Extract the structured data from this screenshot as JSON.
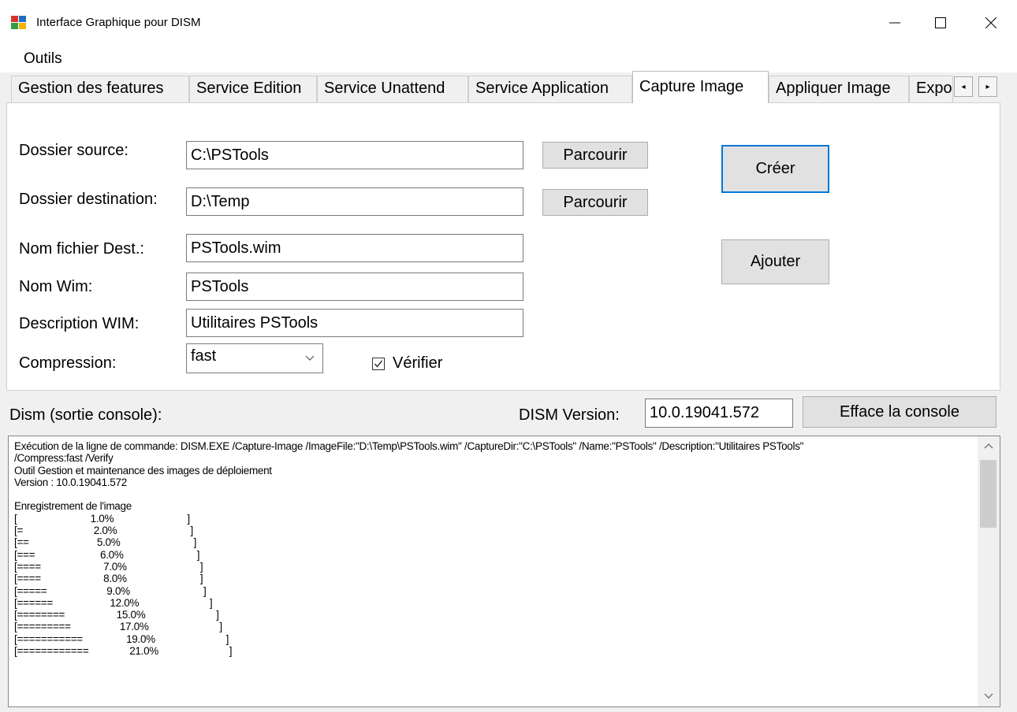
{
  "window": {
    "title": "Interface Graphique pour DISM",
    "minimize_glyph": "—",
    "maximize_glyph": "☐",
    "close_glyph": "✕"
  },
  "menu": {
    "outils": "Outils"
  },
  "tabs": [
    {
      "label": "Gestion des features"
    },
    {
      "label": "Service Edition"
    },
    {
      "label": "Service Unattend"
    },
    {
      "label": "Service Application"
    },
    {
      "label": "Capture Image",
      "active": true
    },
    {
      "label": "Appliquer Image"
    },
    {
      "label": "Exportation"
    }
  ],
  "tab_scroll": {
    "left": "◂",
    "right": "▸"
  },
  "capture": {
    "source_label": "Dossier source:",
    "source_value": "C:\\PSTools",
    "dest_label": "Dossier destination:",
    "dest_value": "D:\\Temp",
    "browse_label": "Parcourir",
    "filename_label": "Nom fichier Dest.:",
    "filename_value": "PSTools.wim",
    "wimname_label": "Nom Wim:",
    "wimname_value": "PSTools",
    "desc_label": "Description WIM:",
    "desc_value": "Utilitaires PSTools",
    "compression_label": "Compression:",
    "compression_value": "fast",
    "verify_label": "Vérifier",
    "verify_checked": true,
    "create_label": "Créer",
    "add_label": "Ajouter"
  },
  "console": {
    "label": "Dism (sortie console):",
    "version_label": "DISM Version:",
    "version_value": "10.0.19041.572",
    "clear_label": "Efface la console",
    "output": "Exécution de la ligne de commande: DISM.EXE /Capture-Image /ImageFile:\"D:\\Temp\\PSTools.wim\" /CaptureDir:\"C:\\PSTools\" /Name:\"PSTools\" /Description:\"Utilitaires PSTools\"\n/Compress:fast /Verify\nOutil Gestion et maintenance des images de déploiement\nVersion : 10.0.19041.572\n\nEnregistrement de l'image\n[                           1.0%                           ]\n[=                          2.0%                           ]\n[==                         5.0%                           ]\n[===                        6.0%                           ]\n[====                       7.0%                           ]\n[====                       8.0%                           ]\n[=====                      9.0%                           ]\n[======                     12.0%                          ]\n[========                   15.0%                          ]\n[=========                  17.0%                          ]\n[===========                19.0%                          ]\n[============               21.0%                          ]"
  },
  "colors": {
    "accent": "#0078d7",
    "window_bg": "#f0f0f0",
    "panel_bg": "#ffffff"
  }
}
